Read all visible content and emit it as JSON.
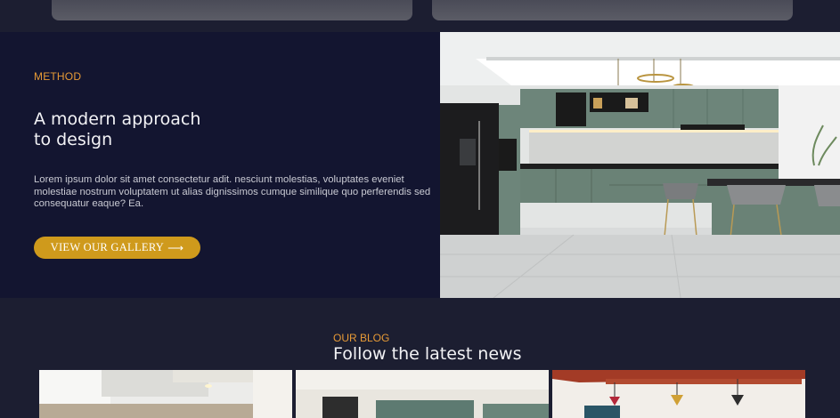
{
  "method": {
    "eyebrow": "METHOD",
    "heading_line1": "A modern approach",
    "heading_line2": "to design",
    "body": "Lorem ipsum dolor sit amet consectetur adit. nesciunt molestias, voluptates eveniet molestiae nostrum voluptatem ut alias dignissimos cumque similique quo perferendis sed consequatur eaque? Ea.",
    "button_label": "VIEW OUR GALLERY",
    "button_arrow": "⟶"
  },
  "blog": {
    "eyebrow": "OUR BLOG",
    "title": "Follow the latest news"
  },
  "colors": {
    "accent": "#e79a36",
    "button": "#cf9a1c",
    "section_dark": "#131530",
    "background": "#1c1e31"
  }
}
